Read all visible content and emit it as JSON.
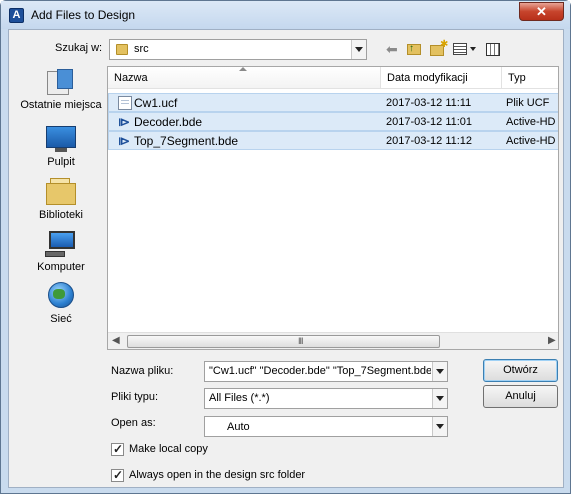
{
  "window": {
    "title": "Add Files to Design",
    "app_icon_letter": "A",
    "close_symbol": "✕"
  },
  "lookin": {
    "label": "Szukaj w:",
    "value": "src"
  },
  "toolbar": {
    "icons": [
      "back-icon",
      "up-folder-icon",
      "new-folder-icon",
      "views-menu-icon",
      "tools-icon"
    ]
  },
  "places": [
    {
      "label": "Ostatnie miejsca",
      "icon": "recent-places-icon"
    },
    {
      "label": "Pulpit",
      "icon": "desktop-icon"
    },
    {
      "label": "Biblioteki",
      "icon": "libraries-icon"
    },
    {
      "label": "Komputer",
      "icon": "computer-icon"
    },
    {
      "label": "Sieć",
      "icon": "network-icon"
    }
  ],
  "filelist": {
    "columns": [
      "Nazwa",
      "Data modyfikacji",
      "Typ"
    ],
    "rows": [
      {
        "name": "Cw1.ucf",
        "date": "2017-03-12 11:11",
        "type": "Plik UCF",
        "icon": "ucf-file-icon",
        "selected": true
      },
      {
        "name": "Decoder.bde",
        "date": "2017-03-12 11:01",
        "type": "Active-HD",
        "icon": "bde-file-icon",
        "selected": true
      },
      {
        "name": "Top_7Segment.bde",
        "date": "2017-03-12 11:12",
        "type": "Active-HD",
        "icon": "bde-file-icon",
        "selected": true
      }
    ],
    "scroll_grip": "III"
  },
  "form": {
    "filename_label": "Nazwa pliku:",
    "filename_value": "\"Cw1.ucf\" \"Decoder.bde\" \"Top_7Segment.bde\"",
    "filetype_label": "Pliki typu:",
    "filetype_value": "All Files (*.*)",
    "openas_label": "Open as:",
    "openas_value": "Auto"
  },
  "buttons": {
    "open_label": "Otwórz",
    "cancel_label": "Anuluj"
  },
  "checkboxes": {
    "make_local_label": "Make local copy",
    "make_local_checked": true,
    "always_open_label": "Always open in the design src folder",
    "always_open_checked": true
  }
}
